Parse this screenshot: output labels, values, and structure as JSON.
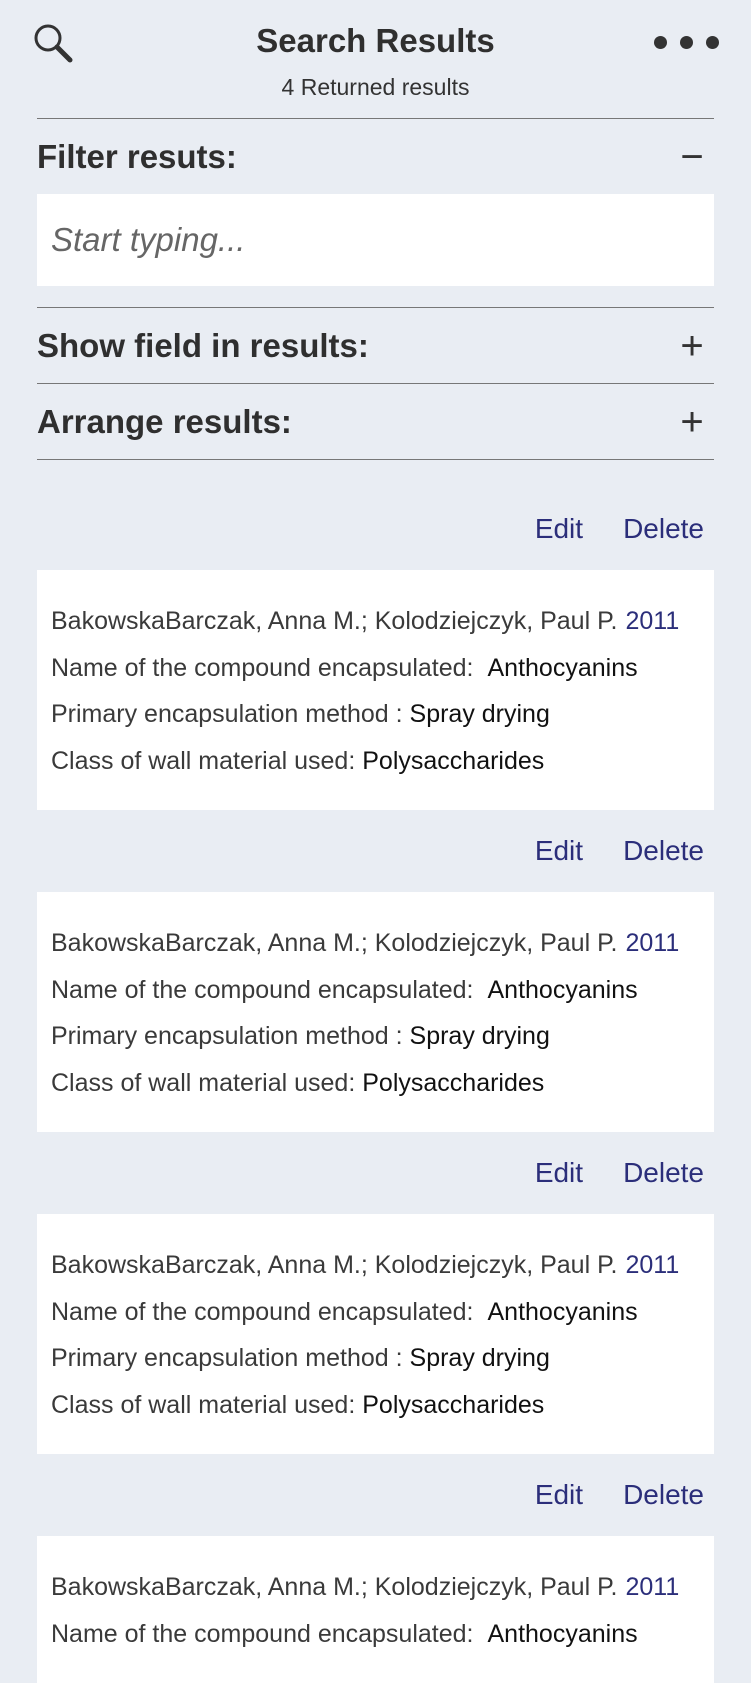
{
  "header": {
    "title": "Search Results",
    "subtitle": "4 Returned results",
    "search_icon": "search-icon",
    "more_icon": "more-horizontal-icon"
  },
  "filter": {
    "label": "Filter resuts:",
    "toggle": "−",
    "placeholder": "Start typing..."
  },
  "show_field": {
    "label": "Show field in results:",
    "toggle": "+"
  },
  "arrange": {
    "label": "Arrange results:",
    "toggle": "+"
  },
  "labels": {
    "edit": "Edit",
    "delete": "Delete",
    "compound": "Name of the compound encapsulated:",
    "method": "Primary encapsulation method :",
    "wall": "Class of wall material used:"
  },
  "results": [
    {
      "authors": "BakowskaBarczak, Anna M.; Kolodziejczyk, Paul P.",
      "year": "2011",
      "compound": "Anthocyanins",
      "method": "Spray drying",
      "wall": "Polysaccharides"
    },
    {
      "authors": "BakowskaBarczak, Anna M.; Kolodziejczyk, Paul P.",
      "year": "2011",
      "compound": "Anthocyanins",
      "method": "Spray drying",
      "wall": "Polysaccharides"
    },
    {
      "authors": "BakowskaBarczak, Anna M.; Kolodziejczyk, Paul P.",
      "year": "2011",
      "compound": "Anthocyanins",
      "method": "Spray drying",
      "wall": "Polysaccharides"
    },
    {
      "authors": "BakowskaBarczak, Anna M.; Kolodziejczyk, Paul P.",
      "year": "2011",
      "compound": "Anthocyanins"
    }
  ],
  "colors": {
    "background": "#e9edf3",
    "link": "#2b2e7a",
    "text": "#333333"
  }
}
